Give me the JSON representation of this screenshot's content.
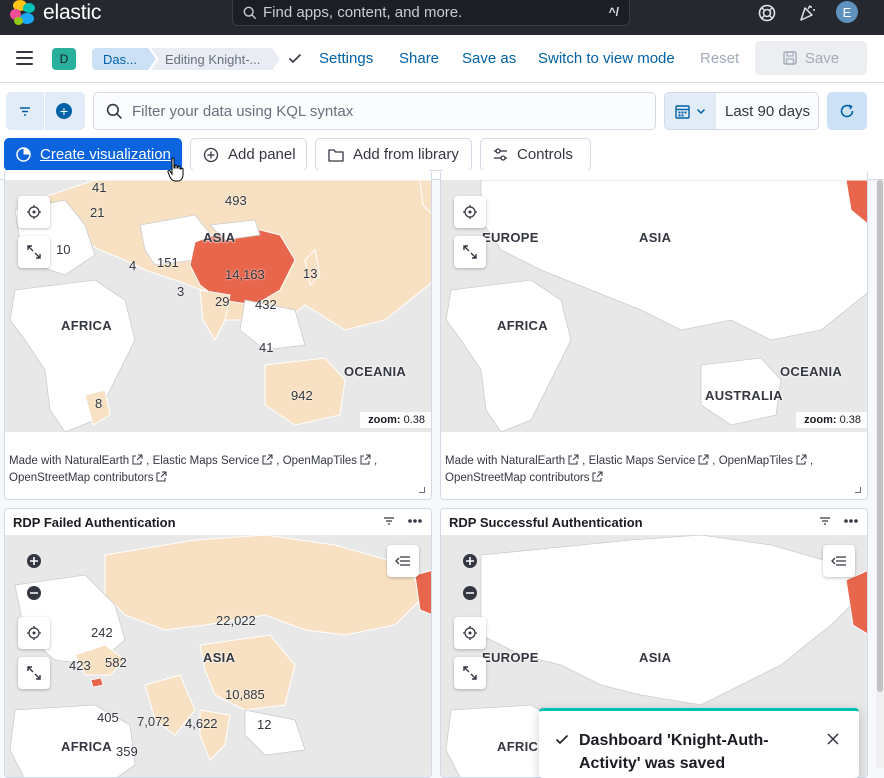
{
  "header": {
    "brand": "elastic",
    "search_placeholder": "Find apps, content, and more.",
    "search_shortcut": "^/",
    "avatar_initial": "E"
  },
  "nav": {
    "space_initial": "D",
    "breadcrumbs": [
      "Das...",
      "Editing Knight-..."
    ],
    "links": {
      "settings": "Settings",
      "share": "Share",
      "save_as": "Save as",
      "switch_mode": "Switch to view mode",
      "reset": "Reset",
      "save": "Save"
    }
  },
  "query": {
    "kql_placeholder": "Filter your data using KQL syntax",
    "date_range": "Last 90 days"
  },
  "toolbar": {
    "create_visualization": "Create visualization",
    "add_panel": "Add panel",
    "add_from_library": "Add from library",
    "controls": "Controls"
  },
  "panels": {
    "top_left": {
      "zoom_label": "zoom:",
      "zoom_value": "0.38",
      "regions": [
        "ASIA",
        "AFRICA",
        "OCEANIA"
      ],
      "counts": [
        "493",
        "41",
        "21",
        "10",
        "4",
        "151",
        "14,163",
        "13",
        "3",
        "29",
        "432",
        "8",
        "942",
        "41"
      ]
    },
    "top_right": {
      "zoom_label": "zoom:",
      "zoom_value": "0.38",
      "regions": [
        "EUROPE",
        "ASIA",
        "AFRICA",
        "OCEANIA",
        "AUSTRALIA"
      ]
    },
    "bottom_left": {
      "title": "RDP Failed Authentication",
      "regions": [
        "ASIA",
        "AFRICA"
      ],
      "counts": [
        "22,022",
        "242",
        "423",
        "582",
        "10,885",
        "405",
        "7,072",
        "4,622",
        "12",
        "359"
      ]
    },
    "bottom_right": {
      "title": "RDP Successful Authentication",
      "regions": [
        "EUROPE",
        "ASIA",
        "AFRICA"
      ]
    },
    "attribution": {
      "natural_earth": "Made with NaturalEarth",
      "ems": "Elastic Maps Service",
      "omt": "OpenMapTiles",
      "osm": "OpenStreetMap contributors"
    }
  },
  "toast": {
    "message": "Dashboard 'Knight-Auth-Activity' was saved"
  },
  "colors": {
    "header_bg": "#25282f",
    "primary": "#0b64dd",
    "link": "#0061a6",
    "map_high": "#e7664c",
    "map_low": "#f8e1c3",
    "toast_accent": "#00bfb3"
  }
}
